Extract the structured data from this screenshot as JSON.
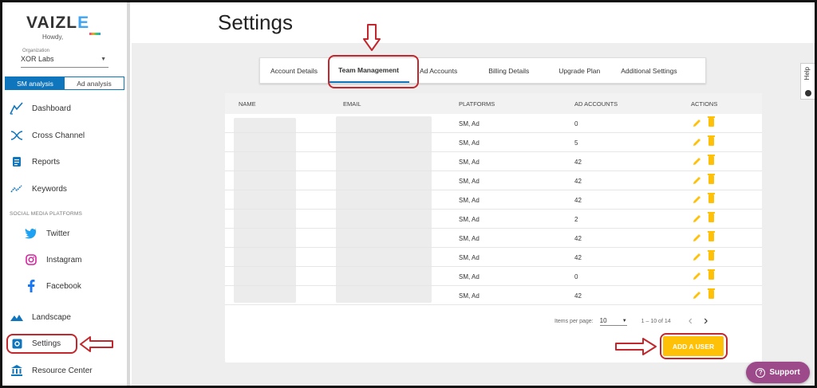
{
  "brand": {
    "logo": "VAIZLE",
    "greeting": "Howdy,"
  },
  "organization": {
    "label": "Organization",
    "value": "XOR Labs"
  },
  "mode_tabs": {
    "sm": "SM analysis",
    "ad": "Ad analysis"
  },
  "nav": {
    "dashboard": "Dashboard",
    "cross_channel": "Cross Channel",
    "reports": "Reports",
    "keywords": "Keywords",
    "section_label": "SOCIAL MEDIA PLATFORMS",
    "twitter": "Twitter",
    "instagram": "Instagram",
    "facebook": "Facebook",
    "landscape": "Landscape",
    "settings": "Settings",
    "resource_center": "Resource Center"
  },
  "page": {
    "title": "Settings"
  },
  "tabs": [
    "Account Details",
    "Team Management",
    "Ad Accounts",
    "Billing Details",
    "Upgrade Plan",
    "Additional Settings"
  ],
  "active_tab": "Team Management",
  "table": {
    "headers": [
      "NAME",
      "EMAIL",
      "PLATFORMS",
      "AD ACCOUNTS",
      "ACTIONS"
    ],
    "rows": [
      {
        "platforms": "SM, Ad",
        "ad_accounts": "0"
      },
      {
        "platforms": "SM, Ad",
        "ad_accounts": "5"
      },
      {
        "platforms": "SM, Ad",
        "ad_accounts": "42"
      },
      {
        "platforms": "SM, Ad",
        "ad_accounts": "42"
      },
      {
        "platforms": "SM, Ad",
        "ad_accounts": "42"
      },
      {
        "platforms": "SM, Ad",
        "ad_accounts": "2"
      },
      {
        "platforms": "SM, Ad",
        "ad_accounts": "42"
      },
      {
        "platforms": "SM, Ad",
        "ad_accounts": "42"
      },
      {
        "platforms": "SM, Ad",
        "ad_accounts": "0"
      },
      {
        "platforms": "SM, Ad",
        "ad_accounts": "42"
      }
    ]
  },
  "pagination": {
    "items_label": "Items per page:",
    "per_page": "10",
    "range": "1 – 10 of 14"
  },
  "add_user_label": "ADD A USER",
  "help_label": "Help",
  "support_label": "Support",
  "colors": {
    "primary": "#0f75bd",
    "accent": "#ffc107",
    "support": "#9c4a8a",
    "annotation": "#c1272d"
  }
}
